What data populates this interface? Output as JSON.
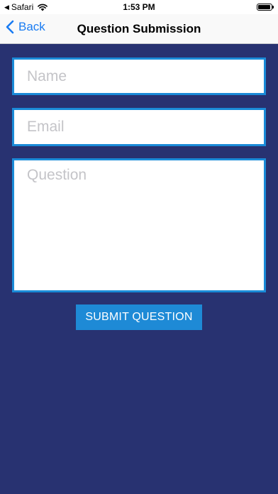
{
  "status_bar": {
    "back_app_label": "Safari",
    "time": "1:53 PM"
  },
  "nav": {
    "back_label": "Back",
    "title": "Question Submission"
  },
  "form": {
    "name_placeholder": "Name",
    "email_placeholder": "Email",
    "question_placeholder": "Question",
    "submit_label": "SUBMIT QUESTION"
  },
  "colors": {
    "background": "#283271",
    "field_border": "#1a8bd8",
    "button": "#1e8ad6",
    "link": "#1a7cf2"
  },
  "icons": {
    "back": "chevron-left-icon",
    "status_back": "triangle-left-icon",
    "wifi": "wifi-icon",
    "battery": "battery-icon"
  }
}
